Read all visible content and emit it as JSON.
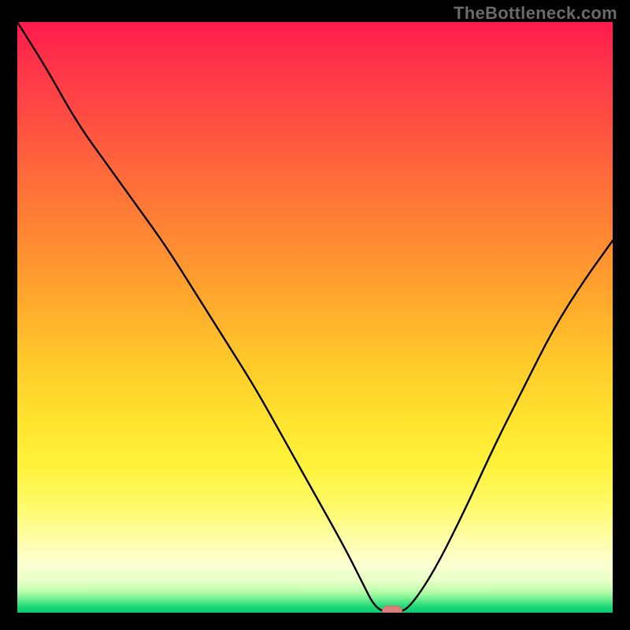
{
  "watermark": {
    "text": "TheBottleneck.com"
  },
  "colors": {
    "background": "#000000",
    "curve_stroke": "#000000",
    "marker_fill": "#d87d78",
    "gradient_top": "#ff1a4f",
    "gradient_bottom": "#0cc86e"
  },
  "chart_data": {
    "type": "line",
    "title": "",
    "xlabel": "",
    "ylabel": "",
    "xlim": [
      0,
      100
    ],
    "ylim": [
      0,
      100
    ],
    "grid": false,
    "legend": false,
    "x": [
      0,
      5,
      10,
      15,
      20,
      25,
      30,
      35,
      40,
      45,
      50,
      55,
      58,
      60,
      62,
      64,
      66,
      70,
      75,
      80,
      85,
      90,
      95,
      100
    ],
    "values": [
      100,
      92,
      83,
      76,
      69,
      62,
      54,
      46,
      38,
      29,
      20,
      11,
      5,
      1,
      0,
      0,
      1,
      7,
      17,
      28,
      38,
      48,
      56,
      63
    ],
    "optimum_x": 63,
    "optimum_y": 0,
    "annotations": [
      {
        "type": "marker",
        "x": 63,
        "y": 0,
        "shape": "pill",
        "color": "#d87d78"
      }
    ]
  }
}
